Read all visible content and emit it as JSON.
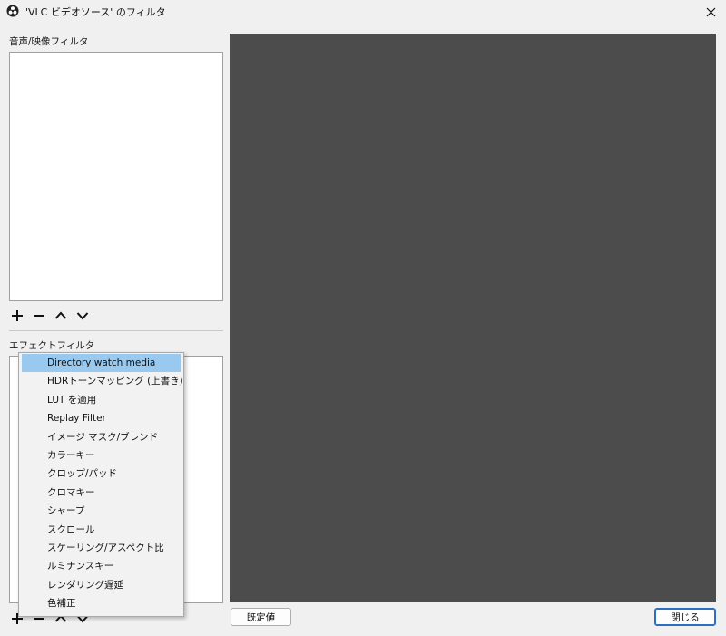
{
  "window": {
    "title": "'VLC ビデオソース' のフィルタ",
    "close_glyph": "✕"
  },
  "audio_video_filters": {
    "label": "音声/映像フィルタ",
    "items": []
  },
  "effect_filters": {
    "label": "エフェクトフィルタ",
    "items": []
  },
  "toolbar": {
    "add": "+",
    "remove": "−",
    "up": "⌃",
    "down": "⌄"
  },
  "context_menu": {
    "items": [
      {
        "label": "Directory watch media",
        "highlighted": true
      },
      {
        "label": "HDRトーンマッピング (上書き)"
      },
      {
        "label": "LUT を適用"
      },
      {
        "label": "Replay Filter"
      },
      {
        "label": "イメージ マスク/ブレンド"
      },
      {
        "label": "カラーキー"
      },
      {
        "label": "クロップ/パッド"
      },
      {
        "label": "クロマキー"
      },
      {
        "label": "シャープ"
      },
      {
        "label": "スクロール"
      },
      {
        "label": "スケーリング/アスペクト比"
      },
      {
        "label": "ルミナンスキー"
      },
      {
        "label": "レンダリング遅延"
      },
      {
        "label": "色補正"
      }
    ]
  },
  "buttons": {
    "defaults": "既定値",
    "close": "閉じる"
  },
  "colors": {
    "preview_bg": "#4c4c4c",
    "menu_highlight": "#99c9ef",
    "primary_border": "#2b6ec4"
  }
}
